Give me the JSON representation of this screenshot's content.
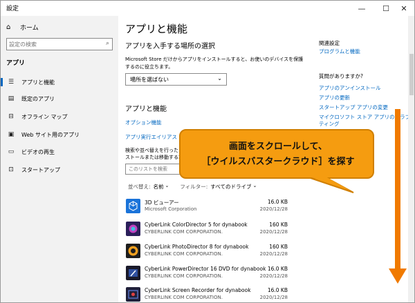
{
  "window": {
    "title": "設定",
    "min": "—",
    "max": "☐",
    "close": "✕"
  },
  "sidebar": {
    "home": {
      "icon": "home-icon",
      "label": "ホーム"
    },
    "search": {
      "placeholder": "設定の検索",
      "icon": "search-icon"
    },
    "section": "アプリ",
    "items": [
      {
        "icon": "apps-features-icon",
        "label": "アプリと機能",
        "active": true
      },
      {
        "icon": "default-apps-icon",
        "label": "既定のアプリ",
        "active": false
      },
      {
        "icon": "offline-maps-icon",
        "label": "オフライン マップ",
        "active": false
      },
      {
        "icon": "web-apps-icon",
        "label": "Web サイト用のアプリ",
        "active": false
      },
      {
        "icon": "video-playback-icon",
        "label": "ビデオの再生",
        "active": false
      },
      {
        "icon": "startup-icon",
        "label": "スタートアップ",
        "active": false
      }
    ]
  },
  "main": {
    "title": "アプリと機能",
    "install_section": {
      "title": "アプリを入手する場所の選択",
      "description": "Microsoft Store だけからアプリをインストールすると、お使いのデバイスを保護するのに役立ちます。",
      "dropdown_value": "場所を選ばない"
    },
    "apps_section": {
      "title": "アプリと機能",
      "links": [
        "オプション機能",
        "アプリ実行エイリアス"
      ],
      "description_line1": "検索や並べ替えを行ったり",
      "description_line2": "ストールまたは移動する場",
      "filter_placeholder": "このリストを検索",
      "sort_label": "並べ替え:",
      "sort_value": "名前",
      "filter_label": "フィルター:",
      "filter_value": "すべてのドライブ"
    },
    "apps": [
      {
        "name": "3D ビューアー",
        "publisher": "Microsoft Corporation",
        "size": "16.0 KB",
        "date": "2020/12/28",
        "icon_color": "#1a73d9"
      },
      {
        "name": "CyberLink ColorDirector 5 for dynabook",
        "publisher": "CYBERLINK COM CORPORATION.",
        "size": "160 KB",
        "date": "2020/12/28",
        "icon_color": "#2a1f5a"
      },
      {
        "name": "CyberLink PhotoDirector 8 for dynabook",
        "publisher": "CYBERLINK COM CORPORATION.",
        "size": "160 KB",
        "date": "2020/12/28",
        "icon_color": "#1e1e1e"
      },
      {
        "name": "CyberLink PowerDirector 16 DVD for dynabook",
        "publisher": "CYBERLINK COM CORPORATION.",
        "size": "16.0 KB",
        "date": "2020/12/28",
        "icon_color": "#1a1a2a"
      },
      {
        "name": "CyberLink Screen Recorder for dynabook",
        "publisher": "CYBERLINK COM CORPORATION.",
        "size": "16.0 KB",
        "date": "2020/12/28",
        "icon_color": "#20203a"
      }
    ]
  },
  "related": {
    "heading": "関連設定",
    "links": [
      "プログラムと機能"
    ]
  },
  "questions": {
    "heading": "質問がありますか?",
    "links": [
      "アプリのアンインストール",
      "アプリの更新",
      "スタートアップ アプリの変更",
      "マイクロソフト ストア アプリのトラブル",
      "ティング"
    ]
  },
  "callout": {
    "line1": "画面をスクロールして、",
    "line2": "［ウイルスバスタークラウド］を探す",
    "color": "#f59c10"
  },
  "arrow_color": "#f07a00"
}
